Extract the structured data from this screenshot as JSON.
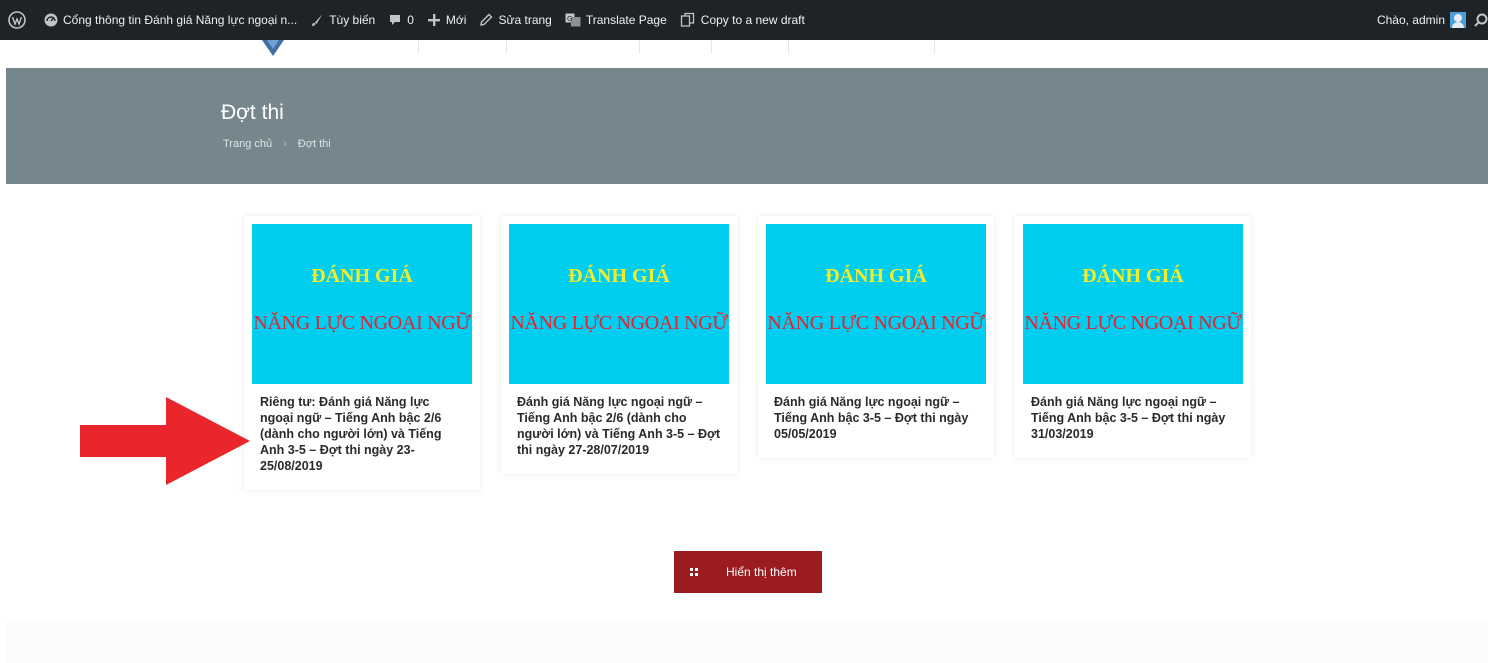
{
  "adminbar": {
    "site_name": "Cổng thông tin Đánh giá Năng lực ngoại n...",
    "customize": "Tùy biến",
    "comments_count": "0",
    "new": "Mới",
    "edit_page": "Sửa trang",
    "translate": "Translate Page",
    "copy_draft": "Copy to a new draft",
    "greeting": "Chào, admin"
  },
  "header": {
    "title": "Đợt thi",
    "breadcrumb_home": "Trang chủ",
    "breadcrumb_current": "Đợt thi"
  },
  "image_text": {
    "line1": "ĐÁNH GIÁ",
    "line2": "NĂNG LỰC NGOẠI NGỮ"
  },
  "cards": [
    {
      "title": "Riêng tư: Đánh giá Năng lực ngoại ngữ – Tiếng Anh bậc 2/6 (dành cho người lớn) và Tiếng Anh 3-5 – Đợt thi ngày 23-25/08/2019"
    },
    {
      "title": "Đánh giá Năng lực ngoại ngữ – Tiếng Anh bậc 2/6 (dành cho người lớn) và Tiếng Anh 3-5 – Đợt thi ngày 27-28/07/2019"
    },
    {
      "title": "Đánh giá Năng lực ngoại ngữ – Tiếng Anh bậc 3-5 – Đợt thi ngày 05/05/2019"
    },
    {
      "title": "Đánh giá Năng lực ngoại ngữ – Tiếng Anh bậc 3-5 – Đợt thi ngày 31/03/2019"
    }
  ],
  "load_more": "Hiển thị thêm",
  "colors": {
    "header_band": "#75868c",
    "card_image_bg": "#00cef0",
    "image_title": "#f3ec2a",
    "image_subtitle": "#e8212a",
    "button": "#9b1c1f",
    "arrow": "#e8262b"
  }
}
